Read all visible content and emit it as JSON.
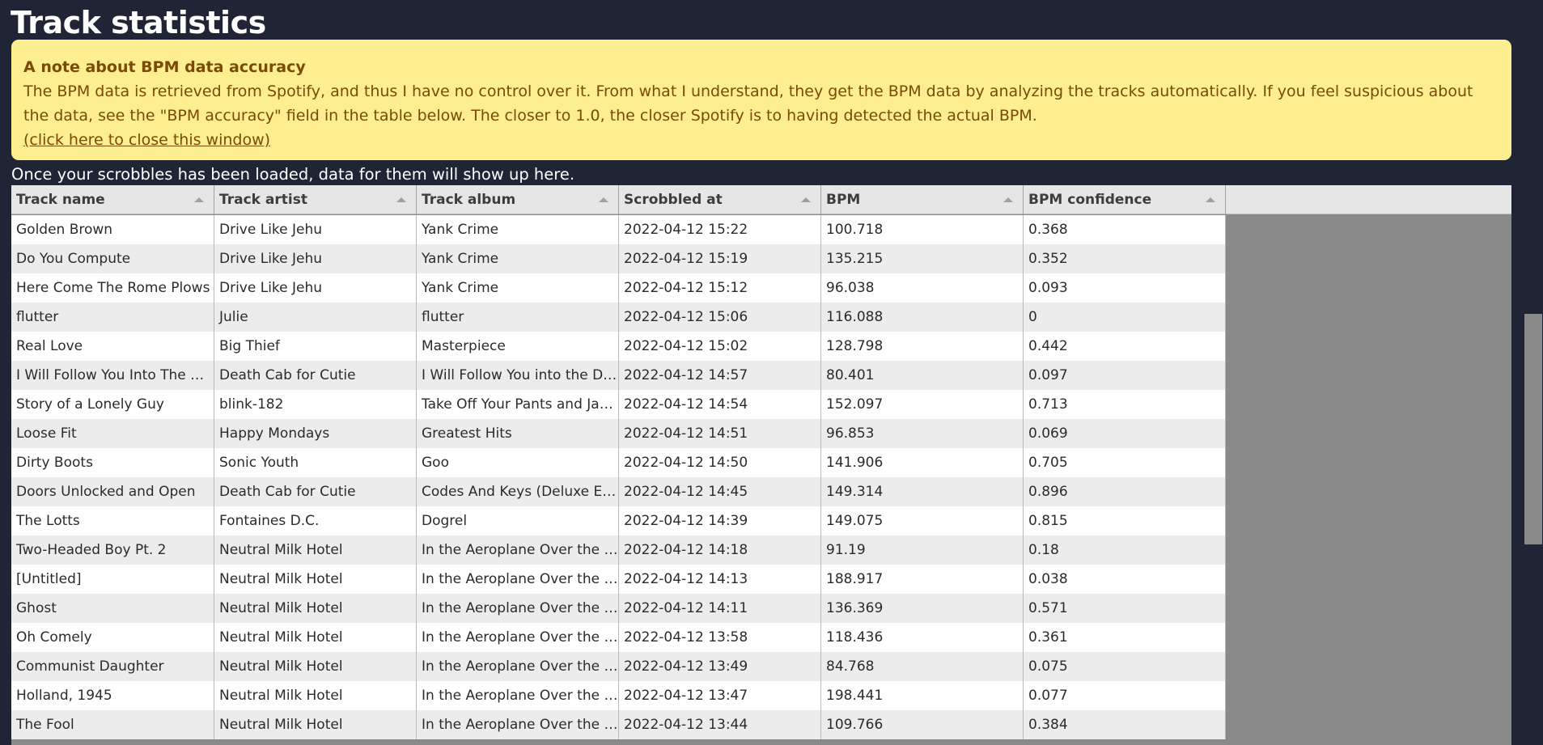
{
  "page": {
    "title": "Track statistics",
    "loaded_note": "Once your scrobbles has been loaded, data for them will show up here."
  },
  "notice": {
    "title": "A note about BPM data accuracy",
    "body": "The BPM data is retrieved from Spotify, and thus I have no control over it. From what I understand, they get the BPM data by analyzing the tracks automatically. If you feel suspicious about the data, see the \"BPM accuracy\" field in the table below. The closer to 1.0, the closer Spotify is to having detected the actual BPM.",
    "close_label": "(click here to close this window)"
  },
  "table": {
    "columns": [
      "Track name",
      "Track artist",
      "Track album",
      "Scrobbled at",
      "BPM",
      "BPM confidence"
    ],
    "rows": [
      [
        "Golden Brown",
        "Drive Like Jehu",
        "Yank Crime",
        "2022-04-12 15:22",
        "100.718",
        "0.368"
      ],
      [
        "Do You Compute",
        "Drive Like Jehu",
        "Yank Crime",
        "2022-04-12 15:19",
        "135.215",
        "0.352"
      ],
      [
        "Here Come The Rome Plows",
        "Drive Like Jehu",
        "Yank Crime",
        "2022-04-12 15:12",
        "96.038",
        "0.093"
      ],
      [
        "flutter",
        "Julie",
        "flutter",
        "2022-04-12 15:06",
        "116.088",
        "0"
      ],
      [
        "Real Love",
        "Big Thief",
        "Masterpiece",
        "2022-04-12 15:02",
        "128.798",
        "0.442"
      ],
      [
        "I Will Follow You Into The Dark",
        "Death Cab for Cutie",
        "I Will Follow You into the Dark",
        "2022-04-12 14:57",
        "80.401",
        "0.097"
      ],
      [
        "Story of a Lonely Guy",
        "blink-182",
        "Take Off Your Pants and Jacket",
        "2022-04-12 14:54",
        "152.097",
        "0.713"
      ],
      [
        "Loose Fit",
        "Happy Mondays",
        "Greatest Hits",
        "2022-04-12 14:51",
        "96.853",
        "0.069"
      ],
      [
        "Dirty Boots",
        "Sonic Youth",
        "Goo",
        "2022-04-12 14:50",
        "141.906",
        "0.705"
      ],
      [
        "Doors Unlocked and Open",
        "Death Cab for Cutie",
        "Codes And Keys (Deluxe Editi…",
        "2022-04-12 14:45",
        "149.314",
        "0.896"
      ],
      [
        "The Lotts",
        "Fontaines D.C.",
        "Dogrel",
        "2022-04-12 14:39",
        "149.075",
        "0.815"
      ],
      [
        "Two-Headed Boy Pt. 2",
        "Neutral Milk Hotel",
        "In the Aeroplane Over the Sea",
        "2022-04-12 14:18",
        "91.19",
        "0.18"
      ],
      [
        "[Untitled]",
        "Neutral Milk Hotel",
        "In the Aeroplane Over the Sea",
        "2022-04-12 14:13",
        "188.917",
        "0.038"
      ],
      [
        "Ghost",
        "Neutral Milk Hotel",
        "In the Aeroplane Over the Sea",
        "2022-04-12 14:11",
        "136.369",
        "0.571"
      ],
      [
        "Oh Comely",
        "Neutral Milk Hotel",
        "In the Aeroplane Over the Sea",
        "2022-04-12 13:58",
        "118.436",
        "0.361"
      ],
      [
        "Communist Daughter",
        "Neutral Milk Hotel",
        "In the Aeroplane Over the Sea",
        "2022-04-12 13:49",
        "84.768",
        "0.075"
      ],
      [
        "Holland, 1945",
        "Neutral Milk Hotel",
        "In the Aeroplane Over the Sea",
        "2022-04-12 13:47",
        "198.441",
        "0.077"
      ],
      [
        "The Fool",
        "Neutral Milk Hotel",
        "In the Aeroplane Over the Sea",
        "2022-04-12 13:44",
        "109.766",
        "0.384"
      ]
    ]
  },
  "colors": {
    "page_background": "#1f2535",
    "notice_background": "#fdee8f",
    "notice_text": "#7a4a06",
    "table_empty_area": "#898989"
  },
  "icons": {
    "sort": "sort-ascending-icon"
  }
}
